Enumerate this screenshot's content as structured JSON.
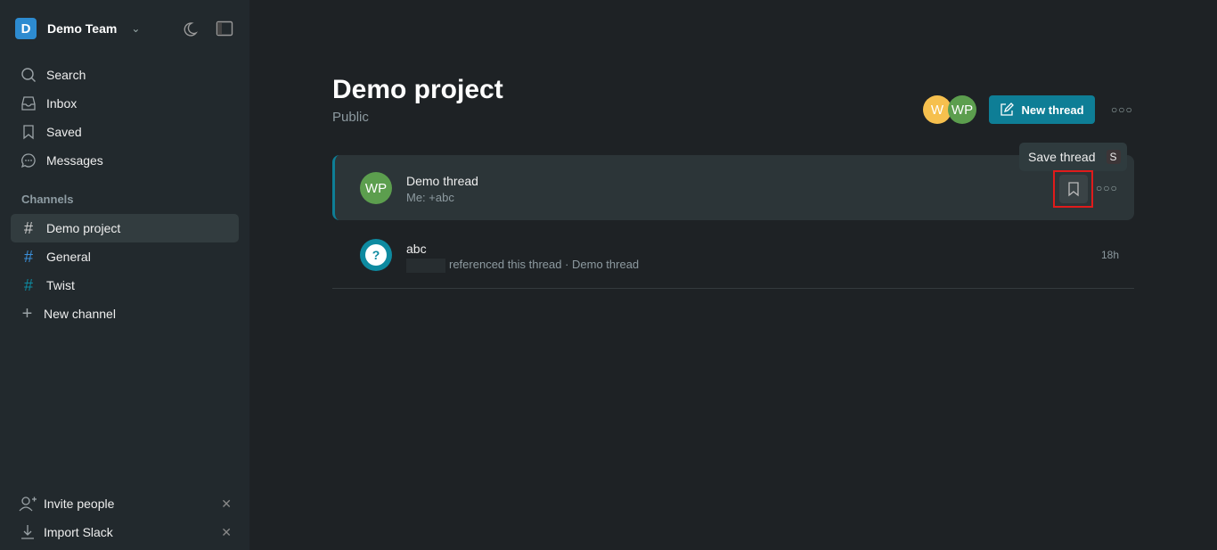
{
  "team": {
    "initial": "D",
    "name": "Demo Team"
  },
  "nav": [
    {
      "label": "Search",
      "icon": "search-icon"
    },
    {
      "label": "Inbox",
      "icon": "inbox-icon"
    },
    {
      "label": "Saved",
      "icon": "bookmark-icon"
    },
    {
      "label": "Messages",
      "icon": "chat-icon"
    }
  ],
  "channels_heading": "Channels",
  "channels": [
    {
      "label": "Demo project",
      "color": "#cccccc",
      "active": true
    },
    {
      "label": "General",
      "color": "#3b8fd9"
    },
    {
      "label": "Twist",
      "color": "#0e8aa0"
    }
  ],
  "new_channel": "New channel",
  "bottom": [
    {
      "label": "Invite people"
    },
    {
      "label": "Import Slack"
    }
  ],
  "header": {
    "title": "Demo project",
    "subtitle": "Public",
    "avatars": [
      {
        "initials": "W",
        "color": "#f6c04e"
      },
      {
        "initials": "WP",
        "color": "#5c9e4e"
      }
    ],
    "new_thread": "New thread"
  },
  "threads": [
    {
      "title": "Demo thread",
      "snippet": "Me: +abc",
      "avatar": "WP",
      "avatar_color": "#5c9e4e"
    },
    {
      "title": "abc",
      "snippet": "referenced this thread · Demo thread",
      "time": "18h",
      "avatar": "?",
      "avatar_color": "#0e8aa0"
    }
  ],
  "tooltip": {
    "label": "Save thread",
    "shortcut": "S"
  },
  "accent": "#0e7e96"
}
